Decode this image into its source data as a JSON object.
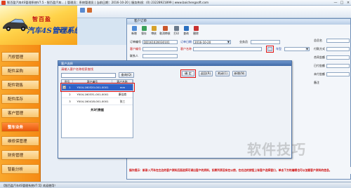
{
  "app": {
    "title": "智百盈汽车4S管理系统V7.5 - 智百盈汽车… | 管理员：系统管理员 | 当前日期：2016-10-20 | 服务热线：(0) 23228921899 | www.baichengsoft.com",
    "minimize": "—",
    "maximize": "□",
    "close": "×"
  },
  "banner": {
    "brand": "智百盈",
    "system": "汽车4S管理系统",
    "version": "V7.5"
  },
  "sidebar": {
    "items": [
      {
        "label": "汽修管理"
      },
      {
        "label": "配件采购"
      },
      {
        "label": "配件销售"
      },
      {
        "label": "配件库存"
      },
      {
        "label": "客户管理"
      },
      {
        "label": "整车业务"
      },
      {
        "label": "维修保管理"
      },
      {
        "label": "财务管理"
      },
      {
        "label": "智能分析"
      }
    ],
    "active_index": 5
  },
  "order_window": {
    "title": "客户订单",
    "toolbar": [
      "新增",
      "保存",
      "审核",
      "取消审核",
      "打印",
      "查询",
      "删除"
    ],
    "fields": {
      "order_no_label": "订单编号",
      "order_no_value": "DD161020030101",
      "order_date_label": "订单日期",
      "order_date_value": "2016-10-20",
      "operator_label": "业务员",
      "customer_no_label": "客户编号",
      "customer_name_label": "客户名称",
      "car_label": "车型",
      "contact_label": "联系人"
    },
    "right_labels": [
      "总员名",
      "付款方式",
      "合同金额",
      "已付金额",
      "未付金额",
      "备注"
    ]
  },
  "dialog": {
    "title": "客户选择",
    "hint": "请输入客户名称检索查找",
    "search_placeholder": "",
    "query_button": "查询(Q)",
    "confirm_button": "确 定",
    "return_button": "返回(R)",
    "close_button": "关闭(C)",
    "new_button": "新增(N)",
    "grid": {
      "headers": [
        "序号",
        "客户编号",
        "客户名称"
      ],
      "rows": [
        {
          "idx": "1",
          "code": "Y004-160320-001-0001",
          "name": "mm"
        },
        {
          "idx": "2",
          "code": "Y004-160331-001-0001",
          "name": "康佳商"
        },
        {
          "idx": "3",
          "code": "Y004-160418-001-0001",
          "name": "张三"
        }
      ],
      "total": "共3行数据"
    }
  },
  "notice": "操作提示：新录入汽车在左边的客户资料后面选择可调出客户的资料，如果列表没有在以前，在右边的按钮上有客户选择窗口，单击下方的编辑也可以加载客户资料的信息。",
  "statusbar": "【智百盈汽车4S管理系统V7.5】欢迎使用！",
  "watermark": "软件技巧",
  "colors": {
    "sidebar": "#f58a14",
    "active_nav": "#e8560c",
    "highlight": "#e01010",
    "selected_row": "#2f62c8"
  },
  "icons": [
    "app-icon",
    "car-icon",
    "new-icon",
    "save-icon",
    "audit-icon",
    "cancel-audit-icon",
    "print-icon",
    "search-icon",
    "delete-icon",
    "close-icon"
  ]
}
